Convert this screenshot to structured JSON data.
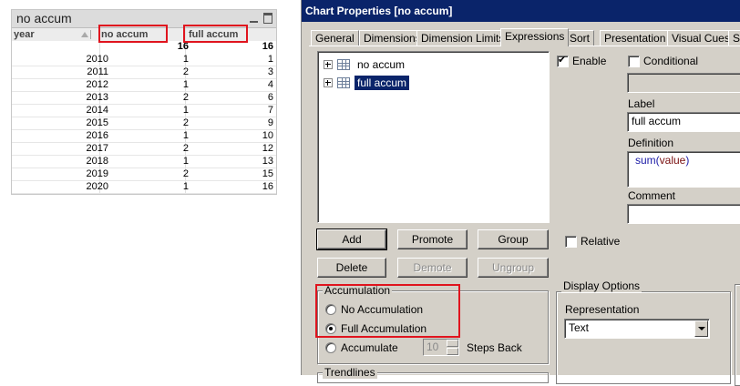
{
  "table": {
    "title": "no accum",
    "headers": [
      "year",
      "no accum",
      "full accum"
    ],
    "totals": [
      "16",
      "16"
    ],
    "rows": [
      [
        "2010",
        "1",
        "1"
      ],
      [
        "2011",
        "2",
        "3"
      ],
      [
        "2012",
        "1",
        "4"
      ],
      [
        "2013",
        "2",
        "6"
      ],
      [
        "2014",
        "1",
        "7"
      ],
      [
        "2015",
        "2",
        "9"
      ],
      [
        "2016",
        "1",
        "10"
      ],
      [
        "2017",
        "2",
        "12"
      ],
      [
        "2018",
        "1",
        "13"
      ],
      [
        "2019",
        "2",
        "15"
      ],
      [
        "2020",
        "1",
        "16"
      ]
    ]
  },
  "dialog": {
    "title": "Chart Properties [no accum]",
    "tabs": [
      "General",
      "Dimensions",
      "Dimension Limits",
      "Expressions",
      "Sort",
      "Presentation",
      "Visual Cues",
      "Sty"
    ],
    "active_tab": "Expressions",
    "expressions": [
      "no accum",
      "full accum"
    ],
    "selected_expression": "full accum",
    "enable_label": "Enable",
    "enable_checked": true,
    "conditional_label": "Conditional",
    "conditional_checked": false,
    "label_caption": "Label",
    "label_value": "full accum",
    "definition_caption": "Definition",
    "definition_func": "sum",
    "definition_open": "(",
    "definition_arg": "value",
    "definition_close": ")",
    "comment_caption": "Comment",
    "buttons": {
      "add": "Add",
      "promote": "Promote",
      "group": "Group",
      "delete": "Delete",
      "demote": "Demote",
      "ungroup": "Ungroup"
    },
    "relative_label": "Relative",
    "relative_checked": false,
    "accumulation": {
      "title": "Accumulation",
      "options": [
        "No Accumulation",
        "Full Accumulation",
        "Accumulate"
      ],
      "selected": "Full Accumulation",
      "steps_value": "10",
      "steps_label": "Steps Back"
    },
    "trendlines_title": "Trendlines",
    "display_options": {
      "title": "Display Options",
      "representation_label": "Representation",
      "representation_value": "Text"
    }
  },
  "colors": {
    "highlight_box": "#e0141e",
    "title_bar": "#0a246a",
    "dialog_bg": "#d4d0c8"
  }
}
